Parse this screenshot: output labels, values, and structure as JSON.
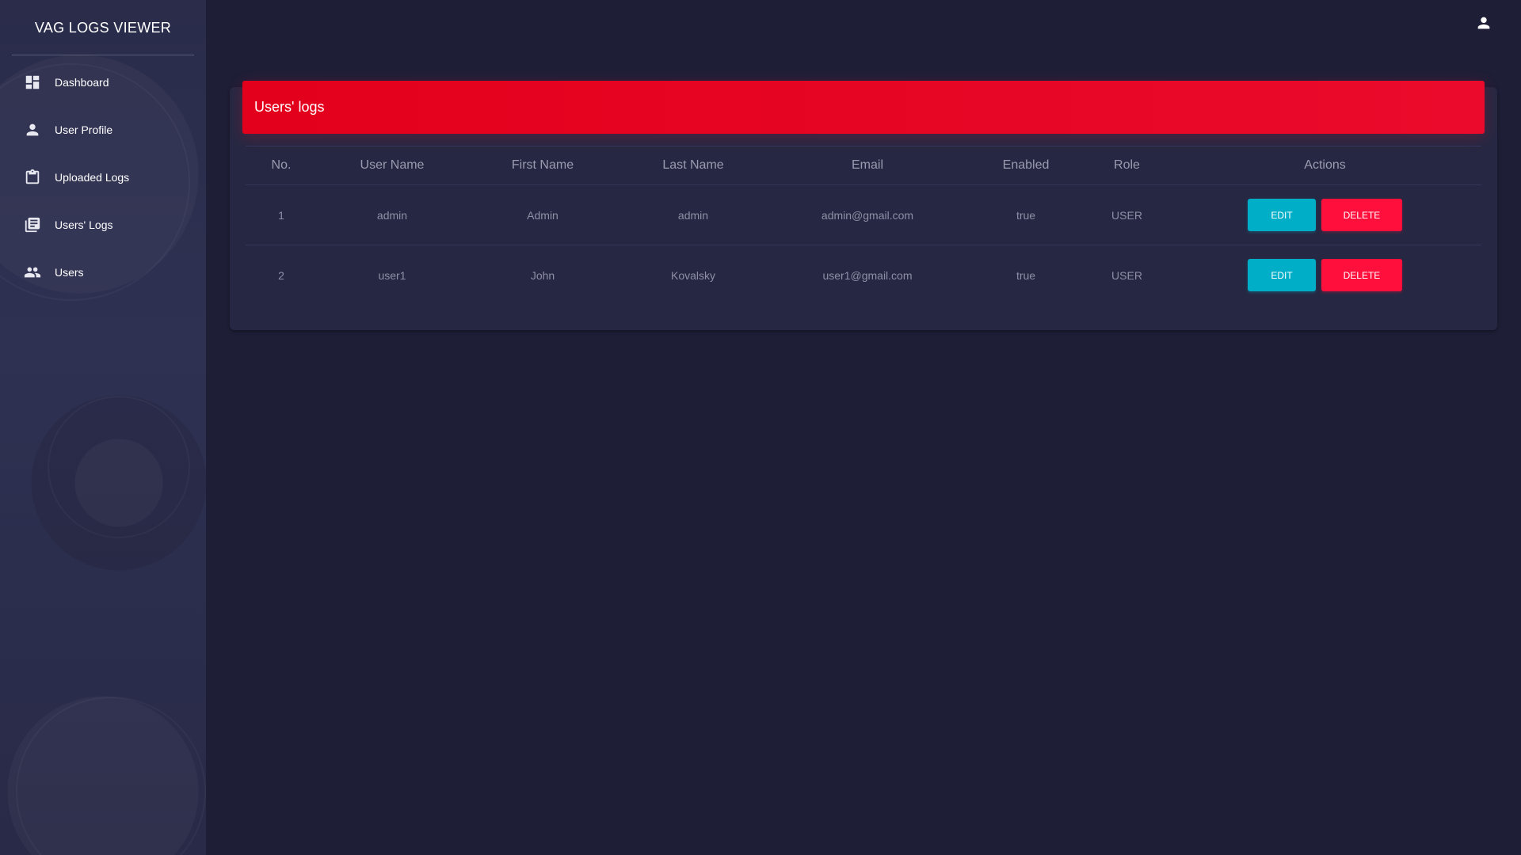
{
  "app": {
    "title": "VAG LOGS VIEWER"
  },
  "sidebar": {
    "items": [
      {
        "label": "Dashboard",
        "icon": "dashboard-icon"
      },
      {
        "label": "User Profile",
        "icon": "person-icon"
      },
      {
        "label": "Uploaded Logs",
        "icon": "clipboard-icon"
      },
      {
        "label": "Users' Logs",
        "icon": "library-books-icon"
      },
      {
        "label": "Users",
        "icon": "people-icon"
      }
    ]
  },
  "header": {
    "user_icon": "person-icon"
  },
  "card": {
    "title": "Users' logs"
  },
  "table": {
    "columns": [
      "No.",
      "User Name",
      "First Name",
      "Last Name",
      "Email",
      "Enabled",
      "Role",
      "Actions"
    ],
    "rows": [
      {
        "no": "1",
        "username": "admin",
        "first_name": "Admin",
        "last_name": "admin",
        "email": "admin@gmail.com",
        "enabled": "true",
        "role": "USER",
        "edit_label": "EDIT",
        "delete_label": "DELETE"
      },
      {
        "no": "2",
        "username": "user1",
        "first_name": "John",
        "last_name": "Kovalsky",
        "email": "user1@gmail.com",
        "enabled": "true",
        "role": "USER",
        "edit_label": "EDIT",
        "delete_label": "DELETE"
      }
    ]
  },
  "colors": {
    "background": "#1e1e37",
    "card": "#262843",
    "header_red": "#e2001c",
    "edit_button": "#00aec7",
    "delete_button": "#ff0f3c"
  }
}
